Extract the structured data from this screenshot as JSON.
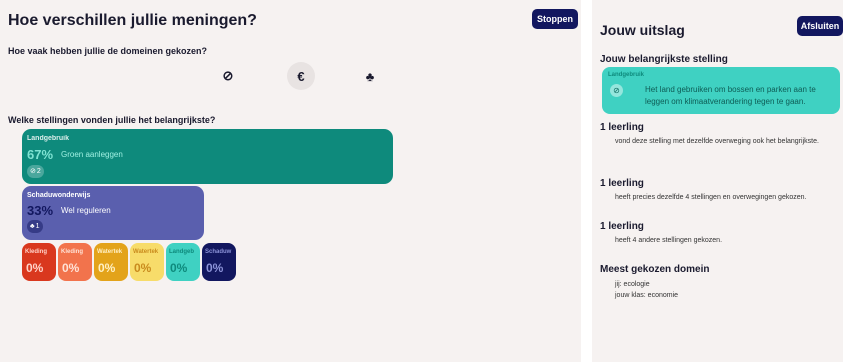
{
  "left": {
    "title": "Hoe verschillen jullie meningen?",
    "stop_label": "Stoppen",
    "question_domains": "Hoe vaak hebben jullie de domeinen gekozen?",
    "domains": [
      {
        "icon": "ecology-icon",
        "glyph": "⊘"
      },
      {
        "icon": "euro-icon",
        "glyph": "€"
      },
      {
        "icon": "people-icon",
        "glyph": "♣"
      }
    ],
    "question_statements": "Welke stellingen vonden jullie het belangrijkste?",
    "cards": [
      {
        "tag": "Landgebruik",
        "pct": "67%",
        "text": "Groen aanleggen",
        "badge": "2",
        "color": "#0e8a7c"
      },
      {
        "tag": "Schaduwonderwijs",
        "pct": "33%",
        "text": "Wel reguleren",
        "badge": "1",
        "color": "#5a5fae"
      }
    ],
    "small_cards": [
      {
        "tag": "Kleding",
        "pct": "0%"
      },
      {
        "tag": "Kleding",
        "pct": "0%"
      },
      {
        "tag": "Watertek",
        "pct": "0%"
      },
      {
        "tag": "Watertek",
        "pct": "0%"
      },
      {
        "tag": "Landgeb",
        "pct": "0%"
      },
      {
        "tag": "Schaduw",
        "pct": "0%"
      }
    ]
  },
  "right": {
    "title": "Jouw uitslag",
    "close_label": "Afsluiten",
    "top_heading": "Jouw belangrijkste stelling",
    "top_statement": {
      "tag": "Landgebruik",
      "text": "Het land gebruiken om bossen en parken aan te leggen om klimaatverandering tegen te gaan."
    },
    "results": [
      {
        "count": "1 leerling",
        "text": "vond deze stelling met dezelfde overweging ook het belangrijkste."
      },
      {
        "count": "1 leerling",
        "text": "heeft precies dezelfde 4 stellingen en overwegingen gekozen."
      },
      {
        "count": "1 leerling",
        "text": "heeft 4 andere stellingen gekozen."
      }
    ],
    "domain_heading": "Meest gekozen domein",
    "domain_you": "jij: ecologie",
    "domain_class": "jouw klas: economie"
  }
}
